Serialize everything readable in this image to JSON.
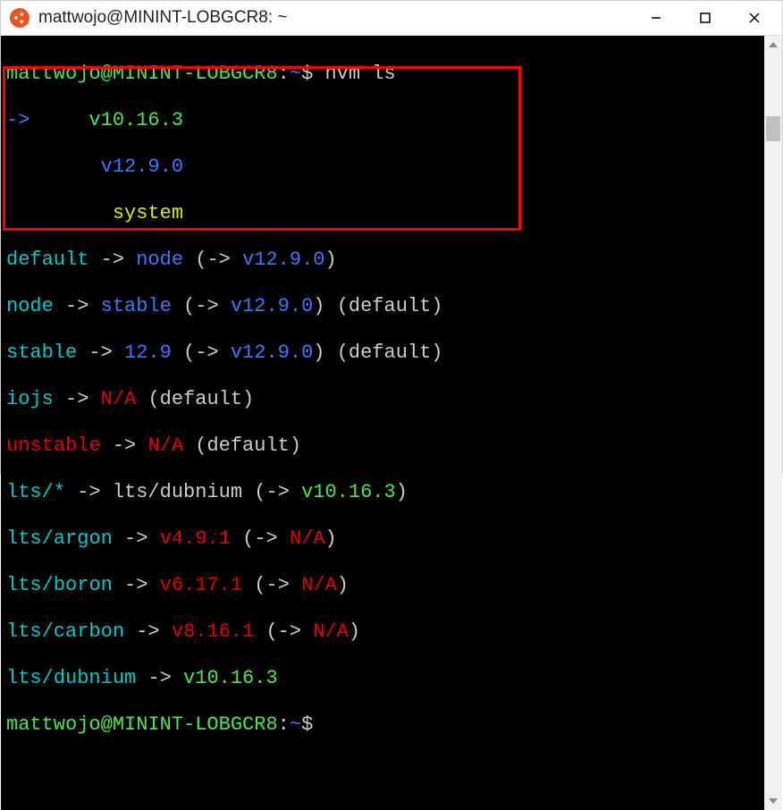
{
  "titlebar": {
    "title": "mattwojo@MININT-LOBGCR8: ~"
  },
  "prompt": {
    "user_host": "mattwojo@MININT-LOBGCR8",
    "colon": ":",
    "path": "~",
    "dollar": "$"
  },
  "command": "nvm ls",
  "output": {
    "arrow": "->",
    "v10": "v10.16.3",
    "v12": "v12.9.0",
    "system": "system",
    "default_label": "default",
    "arrow2": "->",
    "node": "node",
    "open_arrow": "(->",
    "close": ")",
    "stable": "stable",
    "v129short": "12.9",
    "default_suffix": "(default)",
    "iojs": "iojs",
    "na": "N/A",
    "unstable": "unstable",
    "lts_star": "lts/*",
    "lts_dubnium": "lts/dubnium",
    "lts_argon": "lts/argon",
    "lts_boron": "lts/boron",
    "lts_carbon": "lts/carbon",
    "v491": "v4.9.1",
    "v6171": "v6.17.1",
    "v8161": "v8.16.1"
  }
}
